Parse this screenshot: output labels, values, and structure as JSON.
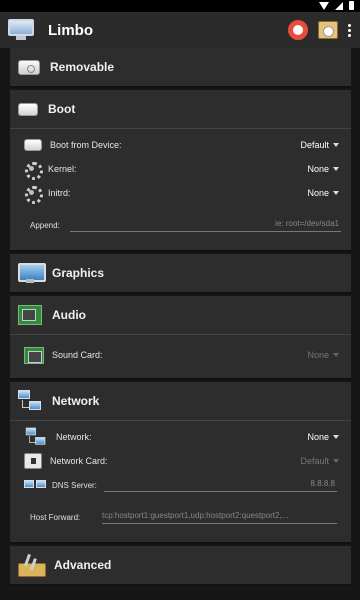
{
  "app": {
    "title": "Limbo"
  },
  "sections": {
    "removable": {
      "label": "Removable"
    },
    "boot": {
      "label": "Boot",
      "boot_device": {
        "label": "Boot from Device:",
        "value": "Default"
      },
      "kernel": {
        "label": "Kernel:",
        "value": "None"
      },
      "initrd": {
        "label": "Initrd:",
        "value": "None"
      },
      "append": {
        "label": "Append:",
        "placeholder": "ie: root=/dev/sda1"
      }
    },
    "graphics": {
      "label": "Graphics"
    },
    "audio": {
      "label": "Audio",
      "sound_card": {
        "label": "Sound Card:",
        "value": "None"
      }
    },
    "network": {
      "label": "Network",
      "network": {
        "label": "Network:",
        "value": "None"
      },
      "network_card": {
        "label": "Network Card:",
        "value": "Default"
      },
      "dns_server": {
        "label": "DNS Server:",
        "value": "8.8.8.8"
      },
      "host_forward": {
        "label": "Host Forward:",
        "value": "tcp:hostport1:guestport1,udp:hostport2:questport2,..."
      }
    },
    "advanced": {
      "label": "Advanced"
    }
  },
  "icons": {
    "app": "monitor-icon",
    "help": "lifebuoy-icon",
    "about": "info-box-icon",
    "menu": "overflow-menu-icon"
  },
  "colors": {
    "appbar": "#2b2b2b",
    "background": "#161616",
    "card": "#2d2d2d",
    "lifebuoy_red": "#e74c3c"
  }
}
